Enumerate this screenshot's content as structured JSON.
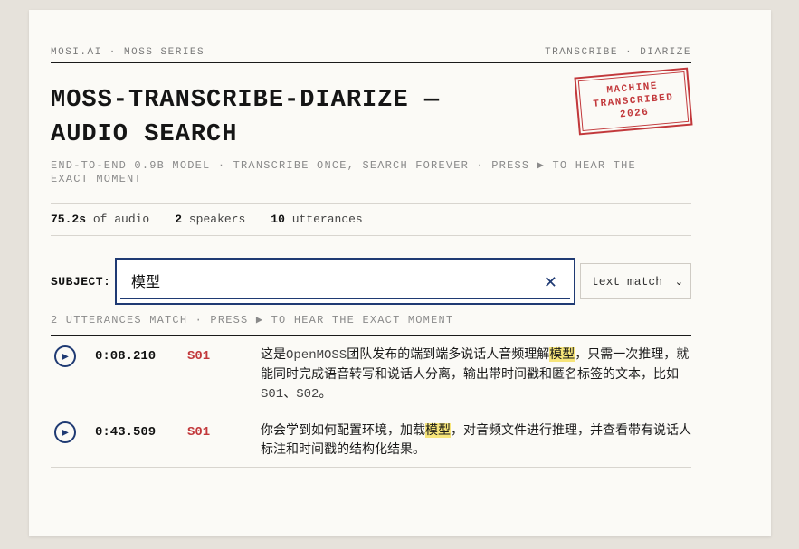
{
  "header": {
    "brand": "MOSI.AI · MOSS SERIES",
    "nav": "TRANSCRIBE · DIARIZE",
    "title_line1": "MOSS-TRANSCRIBE-DIARIZE —",
    "title_line2": "AUDIO SEARCH",
    "subtitle": "END-TO-END 0.9B MODEL · TRANSCRIBE ONCE, SEARCH FOREVER · PRESS ▶ TO HEAR THE EXACT MOMENT",
    "stamp": [
      "MACHINE",
      "TRANSCRIBED",
      "2026"
    ]
  },
  "stats": {
    "duration_value": "75.2s",
    "duration_label": "of audio",
    "speakers_value": "2",
    "speakers_label": "speakers",
    "utterances_value": "10",
    "utterances_label": "utterances"
  },
  "search": {
    "label": "SUBJECT:",
    "value": "模型",
    "clear_icon": "close-icon",
    "mode_selected": "text match"
  },
  "status": "2 UTTERANCES MATCH · PRESS ▶ TO HEAR THE EXACT MOMENT",
  "results": [
    {
      "time": "0:08.210",
      "speaker": "S01",
      "parts": [
        {
          "t": "这是",
          "k": "plain"
        },
        {
          "t": "OpenMOSS",
          "k": "mono"
        },
        {
          "t": "团队发布的端到端多说话人音频理解",
          "k": "plain"
        },
        {
          "t": "模型",
          "k": "hl"
        },
        {
          "t": "，只需一次推理，就能同时完成语音转写和说话人分离，输出带时间戳和匿名标签的文本，比如",
          "k": "plain"
        },
        {
          "t": "S01",
          "k": "mono"
        },
        {
          "t": "、",
          "k": "plain"
        },
        {
          "t": "S02",
          "k": "mono"
        },
        {
          "t": "。",
          "k": "plain"
        }
      ]
    },
    {
      "time": "0:43.509",
      "speaker": "S01",
      "parts": [
        {
          "t": "你会学到如何配置环境，加载",
          "k": "plain"
        },
        {
          "t": "模型",
          "k": "hl"
        },
        {
          "t": "，对音频文件进行推理，并查看带有说话人标注和时间戳的结构化结果。",
          "k": "plain"
        }
      ]
    }
  ],
  "colors": {
    "accent": "#1f3a73",
    "speaker": "#c2383b",
    "highlight": "#f7e57a"
  }
}
